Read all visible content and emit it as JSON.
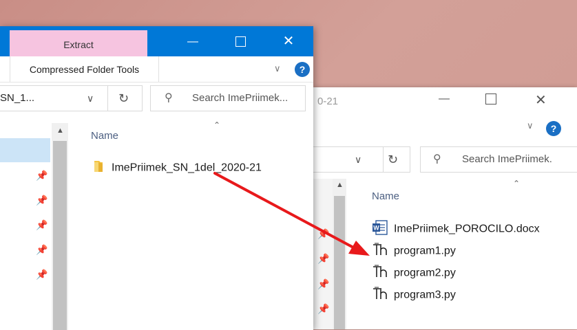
{
  "front": {
    "extract_tab": "Extract",
    "ribbon_tab": "Compressed Folder Tools",
    "address": "SN_1...",
    "search_placeholder": "Search ImePriimek...",
    "column_name": "Name",
    "items": [
      {
        "label": "ImePriimek_SN_1del_2020-21",
        "icon": "folder-icon"
      }
    ]
  },
  "back": {
    "title_fragment": "0-21",
    "search_placeholder": "Search ImePriimek.",
    "column_name": "Name",
    "files": [
      {
        "label": "ImePriimek_POROCILO.docx",
        "icon": "word-doc-icon"
      },
      {
        "label": "program1.py",
        "icon": "python-file-icon"
      },
      {
        "label": "program2.py",
        "icon": "python-file-icon"
      },
      {
        "label": "program3.py",
        "icon": "python-file-icon"
      }
    ]
  },
  "colors": {
    "titlebar": "#0078d7",
    "extract_tab": "#f6c4e0",
    "arrow": "#e8191b",
    "folder": "#f4c542",
    "word": "#2b579a"
  }
}
